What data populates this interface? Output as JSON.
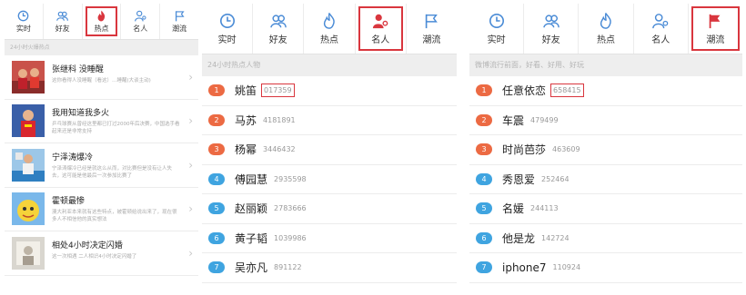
{
  "colors": {
    "accent_red": "#d9363e",
    "icon_blue": "#4a8bd6",
    "rank_orange": "#ec6a43",
    "rank_blue": "#3fa4e0"
  },
  "tabs": [
    {
      "label": "实时",
      "icon": "clock-icon"
    },
    {
      "label": "好友",
      "icon": "friends-icon"
    },
    {
      "label": "热点",
      "icon": "flame-icon"
    },
    {
      "label": "名人",
      "icon": "celebrity-icon"
    },
    {
      "label": "潮流",
      "icon": "flag-icon"
    }
  ],
  "panel_hot": {
    "active_tab": 2,
    "section_label": "24小时火爆热点",
    "items": [
      {
        "title": "张继科 没睡醒",
        "desc": "这你看得人没睡醒（看这）…睡醒(大谈主动)",
        "thumb": "table-tennis-player-thumbnail"
      },
      {
        "title": "我用知道我多火",
        "desc": "乒乓球赛从曾经这里都已打过2000年后决赛，中国选手看起来还是非常支持",
        "thumb": "athlete-thumbnail"
      },
      {
        "title": "宁泽涛爆冷",
        "desc": "宁泽涛爆冷已经是就这么从而，对比赛但是没有让人失去，这可能是他最后一次参加比赛了",
        "thumb": "swimmer-thumbnail"
      },
      {
        "title": "霍顿最惨",
        "desc": "澳大利亚本来就有这些特点，被霍顿给说出来了，现在很多人不相信他的真实想法",
        "thumb": "cartoon-thumbnail"
      },
      {
        "title": "相处4小时决定闪婚",
        "desc": "这一次相遇 二人相识4小时决定闪婚了",
        "thumb": "couple-photo-thumbnail"
      }
    ]
  },
  "panel_celebrity": {
    "active_tab": 3,
    "section_label": "24小时热点人物",
    "items": [
      {
        "rank": "1",
        "name": "姚笛",
        "count": "017359",
        "highlight": true
      },
      {
        "rank": "2",
        "name": "马苏",
        "count": "4181891",
        "highlight": false
      },
      {
        "rank": "3",
        "name": "杨幂",
        "count": "3446432",
        "highlight": false
      },
      {
        "rank": "4",
        "name": "傅园慧",
        "count": "2935598",
        "highlight": false
      },
      {
        "rank": "5",
        "name": "赵丽颖",
        "count": "2783666",
        "highlight": false
      },
      {
        "rank": "6",
        "name": "黄子韬",
        "count": "1039986",
        "highlight": false
      },
      {
        "rank": "7",
        "name": "吴亦凡",
        "count": "891122",
        "highlight": false
      }
    ]
  },
  "panel_trend": {
    "active_tab": 4,
    "section_label": "微博流行前面，好看、好用、好玩",
    "items": [
      {
        "rank": "1",
        "name": "任意依恋",
        "count": "658415",
        "highlight": true
      },
      {
        "rank": "2",
        "name": "车震",
        "count": "479499",
        "highlight": false
      },
      {
        "rank": "3",
        "name": "时尚芭莎",
        "count": "463609",
        "highlight": false
      },
      {
        "rank": "4",
        "name": "秀恩爱",
        "count": "252464",
        "highlight": false
      },
      {
        "rank": "5",
        "name": "名媛",
        "count": "244113",
        "highlight": false
      },
      {
        "rank": "6",
        "name": "他是龙",
        "count": "142724",
        "highlight": false
      },
      {
        "rank": "7",
        "name": "iphone7",
        "count": "110924",
        "highlight": false
      }
    ]
  }
}
